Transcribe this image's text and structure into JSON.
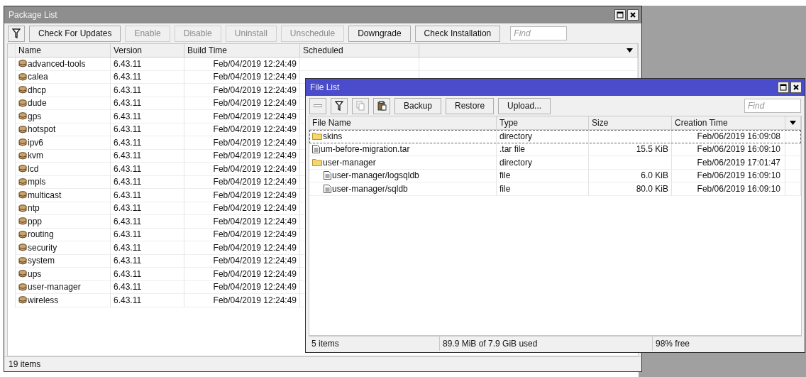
{
  "package_window": {
    "title": "Package List",
    "toolbar": [
      {
        "label": "Check For Updates",
        "disabled": false
      },
      {
        "label": "Enable",
        "disabled": true
      },
      {
        "label": "Disable",
        "disabled": true
      },
      {
        "label": "Uninstall",
        "disabled": true
      },
      {
        "label": "Unschedule",
        "disabled": true
      },
      {
        "label": "Downgrade",
        "disabled": false
      },
      {
        "label": "Check Installation",
        "disabled": false
      }
    ],
    "search": {
      "placeholder": "Find"
    },
    "columns": [
      "Name",
      "Version",
      "Build Time",
      "Scheduled"
    ],
    "rows": [
      {
        "name": "advanced-tools",
        "version": "6.43.11",
        "build_time": "Feb/04/2019 12:24:49"
      },
      {
        "name": "calea",
        "version": "6.43.11",
        "build_time": "Feb/04/2019 12:24:49"
      },
      {
        "name": "dhcp",
        "version": "6.43.11",
        "build_time": "Feb/04/2019 12:24:49"
      },
      {
        "name": "dude",
        "version": "6.43.11",
        "build_time": "Feb/04/2019 12:24:49"
      },
      {
        "name": "gps",
        "version": "6.43.11",
        "build_time": "Feb/04/2019 12:24:49"
      },
      {
        "name": "hotspot",
        "version": "6.43.11",
        "build_time": "Feb/04/2019 12:24:49"
      },
      {
        "name": "ipv6",
        "version": "6.43.11",
        "build_time": "Feb/04/2019 12:24:49"
      },
      {
        "name": "kvm",
        "version": "6.43.11",
        "build_time": "Feb/04/2019 12:24:49"
      },
      {
        "name": "lcd",
        "version": "6.43.11",
        "build_time": "Feb/04/2019 12:24:49"
      },
      {
        "name": "mpls",
        "version": "6.43.11",
        "build_time": "Feb/04/2019 12:24:49"
      },
      {
        "name": "multicast",
        "version": "6.43.11",
        "build_time": "Feb/04/2019 12:24:49"
      },
      {
        "name": "ntp",
        "version": "6.43.11",
        "build_time": "Feb/04/2019 12:24:49"
      },
      {
        "name": "ppp",
        "version": "6.43.11",
        "build_time": "Feb/04/2019 12:24:49"
      },
      {
        "name": "routing",
        "version": "6.43.11",
        "build_time": "Feb/04/2019 12:24:49"
      },
      {
        "name": "security",
        "version": "6.43.11",
        "build_time": "Feb/04/2019 12:24:49"
      },
      {
        "name": "system",
        "version": "6.43.11",
        "build_time": "Feb/04/2019 12:24:49"
      },
      {
        "name": "ups",
        "version": "6.43.11",
        "build_time": "Feb/04/2019 12:24:49"
      },
      {
        "name": "user-manager",
        "version": "6.43.11",
        "build_time": "Feb/04/2019 12:24:49"
      },
      {
        "name": "wireless",
        "version": "6.43.11",
        "build_time": "Feb/04/2019 12:24:49"
      }
    ],
    "status_bar": "19 items"
  },
  "file_window": {
    "title": "File List",
    "toolbar": [
      {
        "label": "Backup"
      },
      {
        "label": "Restore"
      },
      {
        "label": "Upload..."
      }
    ],
    "search": {
      "placeholder": "Find"
    },
    "columns": [
      "File Name",
      "Type",
      "Size",
      "Creation Time"
    ],
    "rows": [
      {
        "kind": "directory",
        "name": "skins",
        "type": "directory",
        "creation_time": "Feb/06/2019 16:09:08",
        "selected": true
      },
      {
        "kind": "file",
        "name": "um-before-migration.tar",
        "type": ".tar file",
        "size": "15.5 KiB",
        "creation_time": "Feb/06/2019 16:09:10",
        "selected": false
      },
      {
        "kind": "directory",
        "name": "user-manager",
        "type": "directory",
        "creation_time": "Feb/06/2019 17:01:47",
        "selected": false,
        "children": [
          {
            "kind": "file",
            "name": "user-manager/logsqldb",
            "type": "file",
            "size": "6.0 KiB",
            "creation_time": "Feb/06/2019 16:09:10",
            "selected": false
          },
          {
            "kind": "file",
            "name": "user-manager/sqldb",
            "type": "file",
            "size": "80.0 KiB",
            "creation_time": "Feb/06/2019 16:09:10",
            "selected": false
          }
        ]
      }
    ],
    "status_bar": [
      "5 items",
      "89.9 MiB of 7.9 GiB used",
      "98% free"
    ]
  }
}
